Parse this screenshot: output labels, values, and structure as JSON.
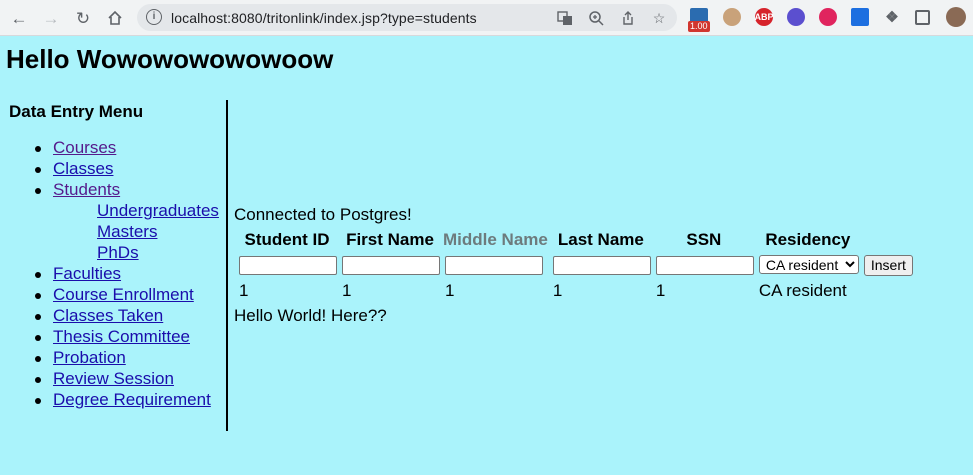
{
  "browser": {
    "url": "localhost:8080/tritonlink/index.jsp?type=students",
    "zoom_badge": "1.00",
    "extensions": [
      "ABP"
    ]
  },
  "page": {
    "title": "Hello Wowowowowowoow"
  },
  "sidebar": {
    "heading": "Data Entry Menu",
    "items": [
      {
        "label": "Courses"
      },
      {
        "label": "Classes"
      },
      {
        "label": "Students"
      },
      {
        "label": "Undergraduates"
      },
      {
        "label": "Masters"
      },
      {
        "label": "PhDs"
      },
      {
        "label": "Faculties"
      },
      {
        "label": "Course Enrollment"
      },
      {
        "label": "Classes Taken"
      },
      {
        "label": "Thesis Committee"
      },
      {
        "label": "Probation"
      },
      {
        "label": "Review Session"
      },
      {
        "label": "Degree Requirement"
      }
    ]
  },
  "main": {
    "status": "Connected to Postgres!",
    "columns": [
      "Student ID",
      "First Name",
      "Middle Name",
      "Last Name",
      "SSN",
      "Residency"
    ],
    "residency_selected": "CA resident",
    "insert_label": "Insert",
    "rows": [
      [
        "1",
        "1",
        "1",
        "1",
        "1",
        "CA resident"
      ]
    ],
    "footer_text": "Hello World! Here??"
  }
}
